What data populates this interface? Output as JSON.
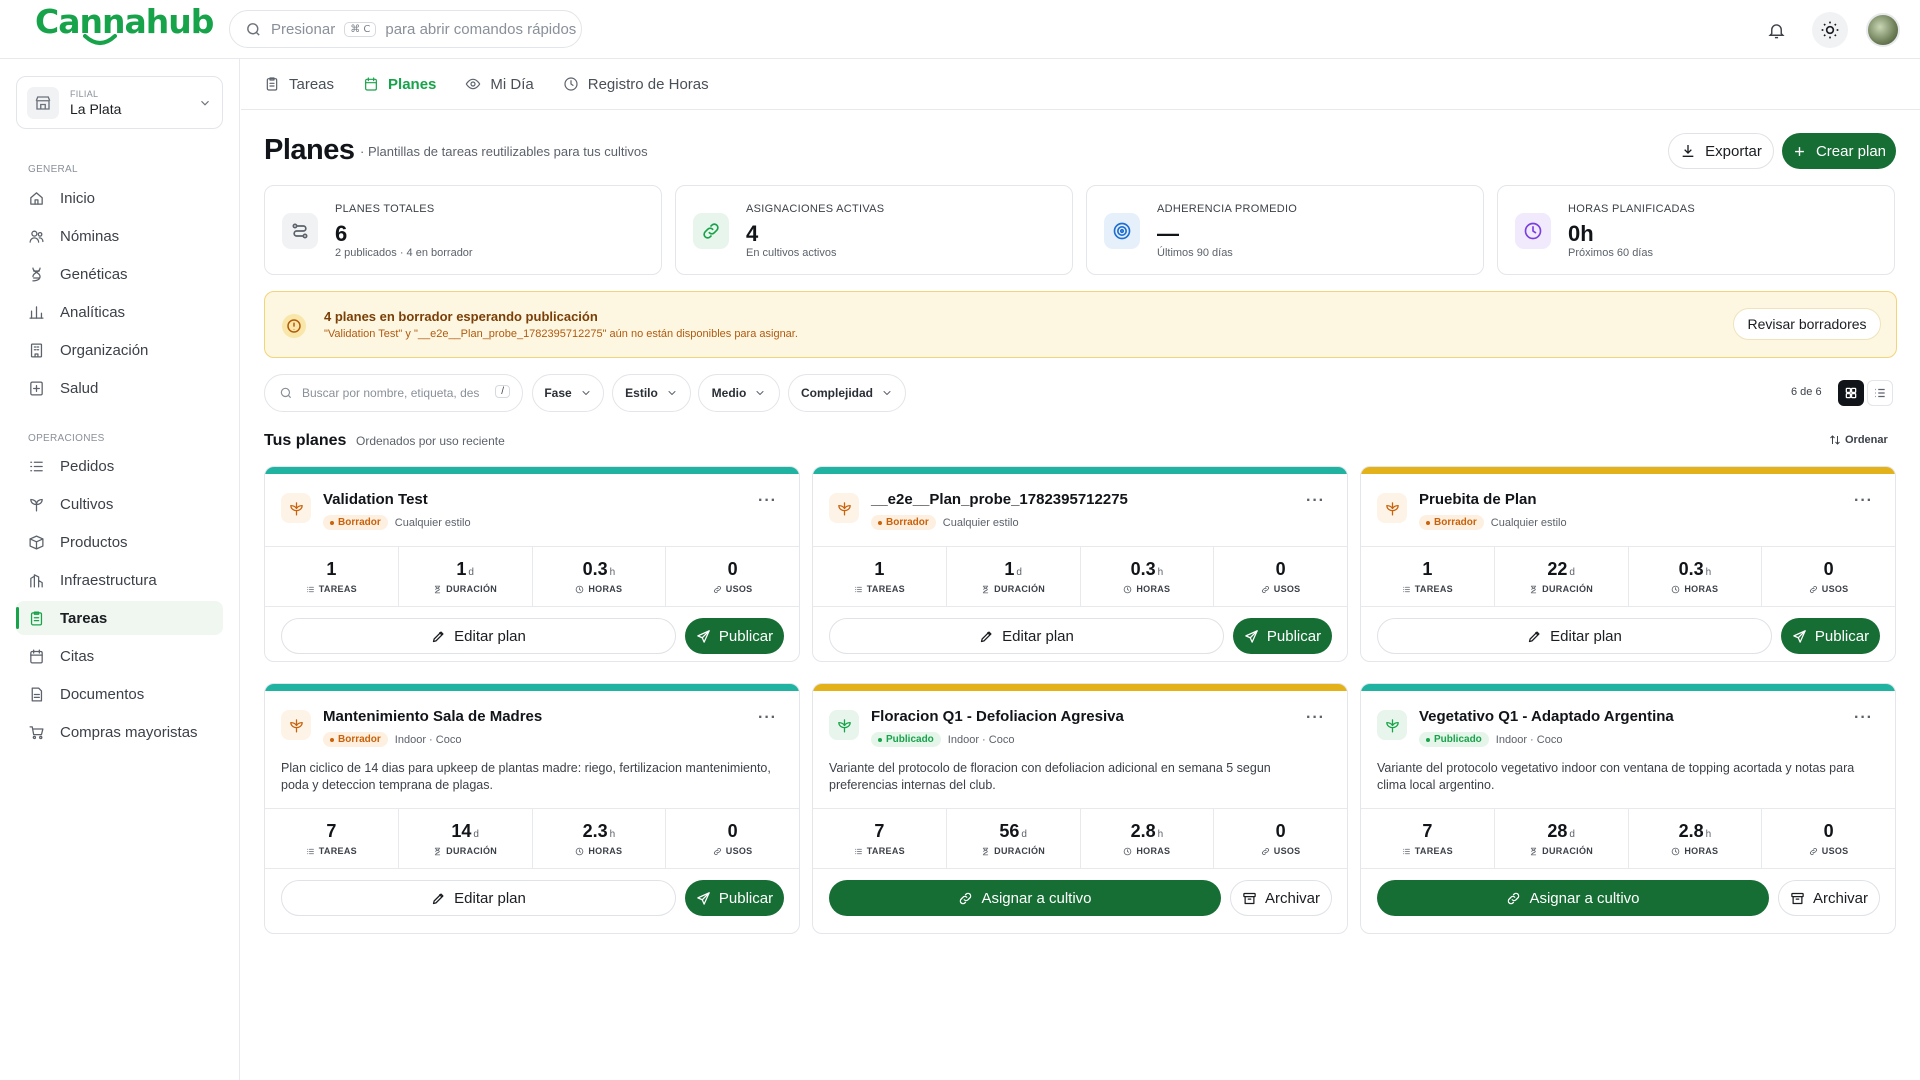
{
  "app": {
    "brand": "Cannahub"
  },
  "search": {
    "text": "Presionar",
    "shortcut": "⌘ C",
    "after": "para abrir comandos rápidos"
  },
  "branch": {
    "caption": "FILIAL",
    "value": "La Plata"
  },
  "sidebar": {
    "general_label": "GENERAL",
    "general": [
      {
        "label": "Inicio",
        "icon": "home-icon"
      },
      {
        "label": "Nóminas",
        "icon": "users-icon"
      },
      {
        "label": "Genéticas",
        "icon": "dna-icon"
      },
      {
        "label": "Analíticas",
        "icon": "chart-icon"
      },
      {
        "label": "Organización",
        "icon": "building-icon"
      },
      {
        "label": "Salud",
        "icon": "health-icon"
      }
    ],
    "ops_label": "OPERACIONES",
    "ops": [
      {
        "label": "Pedidos",
        "icon": "list-icon"
      },
      {
        "label": "Cultivos",
        "icon": "plant-icon"
      },
      {
        "label": "Productos",
        "icon": "box-icon"
      },
      {
        "label": "Infraestructura",
        "icon": "infra-icon"
      },
      {
        "label": "Tareas",
        "icon": "clipboard-icon",
        "active": true
      },
      {
        "label": "Citas",
        "icon": "calendar-icon"
      },
      {
        "label": "Documentos",
        "icon": "document-icon"
      },
      {
        "label": "Compras mayoristas",
        "icon": "cart-icon"
      }
    ]
  },
  "tabs": [
    {
      "label": "Tareas",
      "icon": "clipboard-icon"
    },
    {
      "label": "Planes",
      "icon": "calendar-icon",
      "active": true
    },
    {
      "label": "Mi Día",
      "icon": "eye-icon"
    },
    {
      "label": "Registro de Horas",
      "icon": "clock-icon"
    }
  ],
  "page": {
    "title": "Planes",
    "subtitle": "· Plantillas de tareas reutilizables para tus cultivos",
    "export_label": "Exportar",
    "create_label": "Crear plan"
  },
  "stats": [
    {
      "label": "PLANES TOTALES",
      "value": "6",
      "sub": "2 publicados · 4 en borrador",
      "icon": "flow-icon",
      "color": "#5c626b",
      "bg": "#f1f2f4"
    },
    {
      "label": "ASIGNACIONES ACTIVAS",
      "value": "4",
      "sub": "En cultivos activos",
      "icon": "link-icon",
      "color": "#17a34a",
      "bg": "#e8f5ec"
    },
    {
      "label": "ADHERENCIA PROMEDIO",
      "value": "—",
      "sub": "Últimos 90 días",
      "icon": "target-icon",
      "color": "#1d6fd1",
      "bg": "#e6f0fb"
    },
    {
      "label": "HORAS PLANIFICADAS",
      "value": "0h",
      "sub": "Próximos 60 días",
      "icon": "clock-icon",
      "color": "#7a3fe0",
      "bg": "#f1eafc"
    }
  ],
  "alert": {
    "title": "4 planes en borrador esperando publicación",
    "text": "\"Validation Test\" y \"__e2e__Plan_probe_1782395712275\" aún no están disponibles para asignar.",
    "button": "Revisar borradores"
  },
  "filters": {
    "search_placeholder": "Buscar por nombre, etiqueta, des",
    "slash": "/",
    "chips": [
      "Fase",
      "Estilo",
      "Medio",
      "Complejidad"
    ],
    "count": "6 de 6"
  },
  "list": {
    "title": "Tus planes",
    "subtitle": "Ordenados por uso reciente",
    "sort_label": "Ordenar"
  },
  "metric_labels": {
    "tasks": "TAREAS",
    "duration": "DURACIÓN",
    "hours": "HORAS",
    "uses": "USOS"
  },
  "units": {
    "days": "d",
    "hours": "h"
  },
  "plans": [
    {
      "title": "Validation Test",
      "status": "Borrador",
      "meta": "Cualquier estilo",
      "desc": "",
      "tasks": "1",
      "duration": "1",
      "hours": "0.3",
      "uses": "0",
      "bar_color": "#20b3a1",
      "primary": "Editar plan",
      "secondary": "Publicar"
    },
    {
      "title": "__e2e__Plan_probe_1782395712275",
      "status": "Borrador",
      "meta": "Cualquier estilo",
      "desc": "",
      "tasks": "1",
      "duration": "1",
      "hours": "0.3",
      "uses": "0",
      "bar_color": "#20b3a1",
      "primary": "Editar plan",
      "secondary": "Publicar"
    },
    {
      "title": "Pruebita de Plan",
      "status": "Borrador",
      "meta": "Cualquier estilo",
      "desc": "",
      "tasks": "1",
      "duration": "22",
      "hours": "0.3",
      "uses": "0",
      "bar_color": "#e3b21a",
      "primary": "Editar plan",
      "secondary": "Publicar"
    },
    {
      "title": "Mantenimiento Sala de Madres",
      "status": "Borrador",
      "meta": "Indoor · Coco",
      "desc": "Plan ciclico de 14 dias para upkeep de plantas madre: riego, fertilizacion mantenimiento, poda y deteccion temprana de plagas.",
      "tasks": "7",
      "duration": "14",
      "hours": "2.3",
      "uses": "0",
      "bar_color": "#20b3a1",
      "primary": "Editar plan",
      "secondary": "Publicar"
    },
    {
      "title": "Floracion Q1 - Defoliacion Agresiva",
      "status": "Publicado",
      "meta": "Indoor · Coco",
      "desc": "Variante del protocolo de floracion con defoliacion adicional en semana 5 segun preferencias internas del club.",
      "tasks": "7",
      "duration": "56",
      "hours": "2.8",
      "uses": "0",
      "bar_color": "#e3b21a",
      "primary": "Asignar a cultivo",
      "secondary": "Archivar"
    },
    {
      "title": "Vegetativo Q1 - Adaptado Argentina",
      "status": "Publicado",
      "meta": "Indoor · Coco",
      "desc": "Variante del protocolo vegetativo indoor con ventana de topping acortada y notas para clima local argentino.",
      "tasks": "7",
      "duration": "28",
      "hours": "2.8",
      "uses": "0",
      "bar_color": "#20b3a1",
      "primary": "Asignar a cultivo",
      "secondary": "Archivar"
    }
  ],
  "colors": {
    "accent": "#17a34a",
    "primary_button": "#166e34",
    "draft": "#c9620a",
    "published": "#17a34a"
  }
}
